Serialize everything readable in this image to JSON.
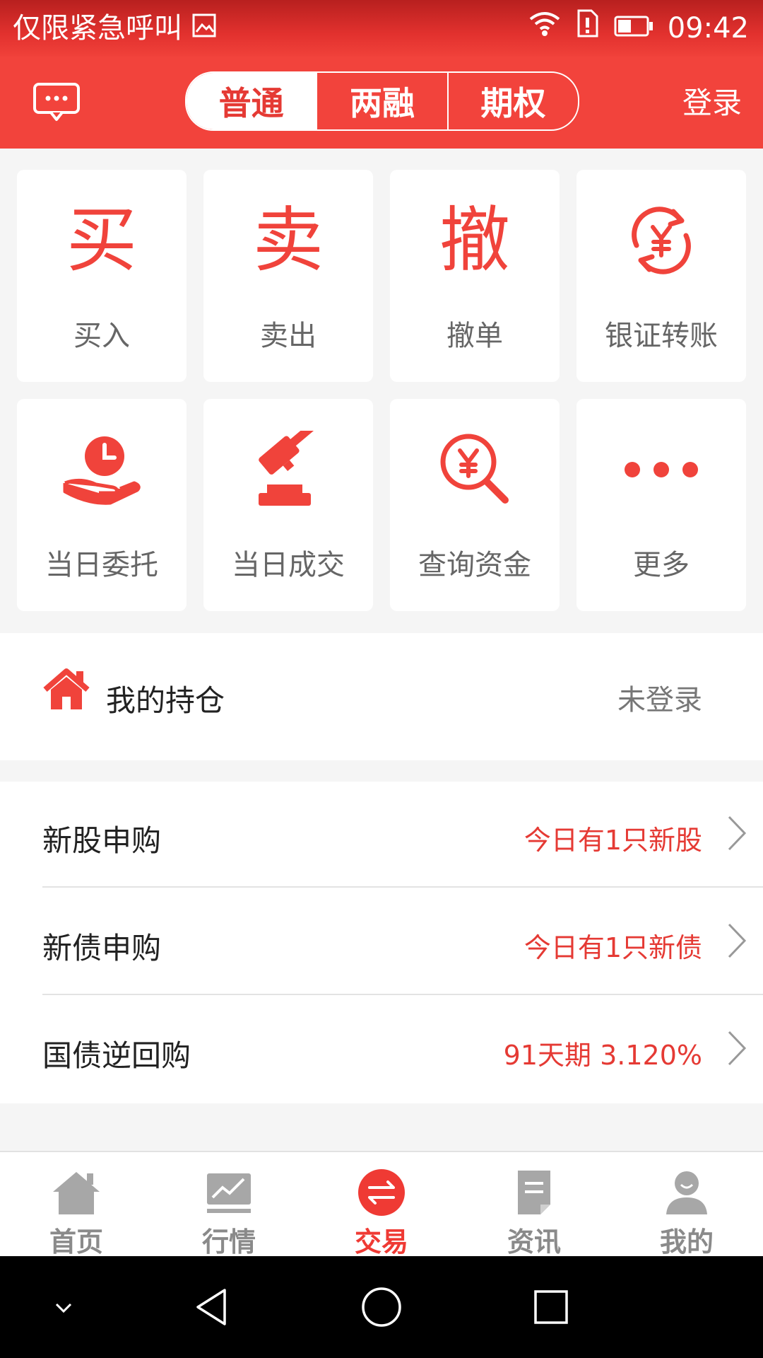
{
  "status_bar": {
    "carrier_text": "仅限紧急呼叫",
    "time": "09:42"
  },
  "top_bar": {
    "tabs": [
      {
        "label": "普通",
        "active": true
      },
      {
        "label": "两融",
        "active": false
      },
      {
        "label": "期权",
        "active": false
      }
    ],
    "login_label": "登录"
  },
  "quick_actions": [
    {
      "label": "买入",
      "glyph": "买",
      "icon": "buy-icon"
    },
    {
      "label": "卖出",
      "glyph": "卖",
      "icon": "sell-icon"
    },
    {
      "label": "撤单",
      "glyph": "撤",
      "icon": "cancel-order-icon"
    },
    {
      "label": "银证转账",
      "icon": "bank-transfer-icon"
    },
    {
      "label": "当日委托",
      "icon": "order-clock-icon"
    },
    {
      "label": "当日成交",
      "icon": "gavel-icon"
    },
    {
      "label": "查询资金",
      "icon": "fund-search-icon"
    },
    {
      "label": "更多",
      "icon": "more-icon"
    }
  ],
  "holdings": {
    "title": "我的持仓",
    "status": "未登录"
  },
  "subscriptions": [
    {
      "name": "新股申购",
      "value": "今日有1只新股"
    },
    {
      "name": "新债申购",
      "value": "今日有1只新债"
    },
    {
      "name": "国债逆回购",
      "value": "91天期 3.120%"
    }
  ],
  "tab_bar": [
    {
      "label": "首页",
      "icon": "home-icon",
      "active": false
    },
    {
      "label": "行情",
      "icon": "market-chart-icon",
      "active": false
    },
    {
      "label": "交易",
      "icon": "trade-exchange-icon",
      "active": true
    },
    {
      "label": "资讯",
      "icon": "news-icon",
      "active": false
    },
    {
      "label": "我的",
      "icon": "profile-icon",
      "active": false
    }
  ],
  "colors": {
    "brand_red": "#f2433c",
    "accent_text_red": "#e53a34",
    "tab_inactive_gray": "#8a8a8a"
  }
}
